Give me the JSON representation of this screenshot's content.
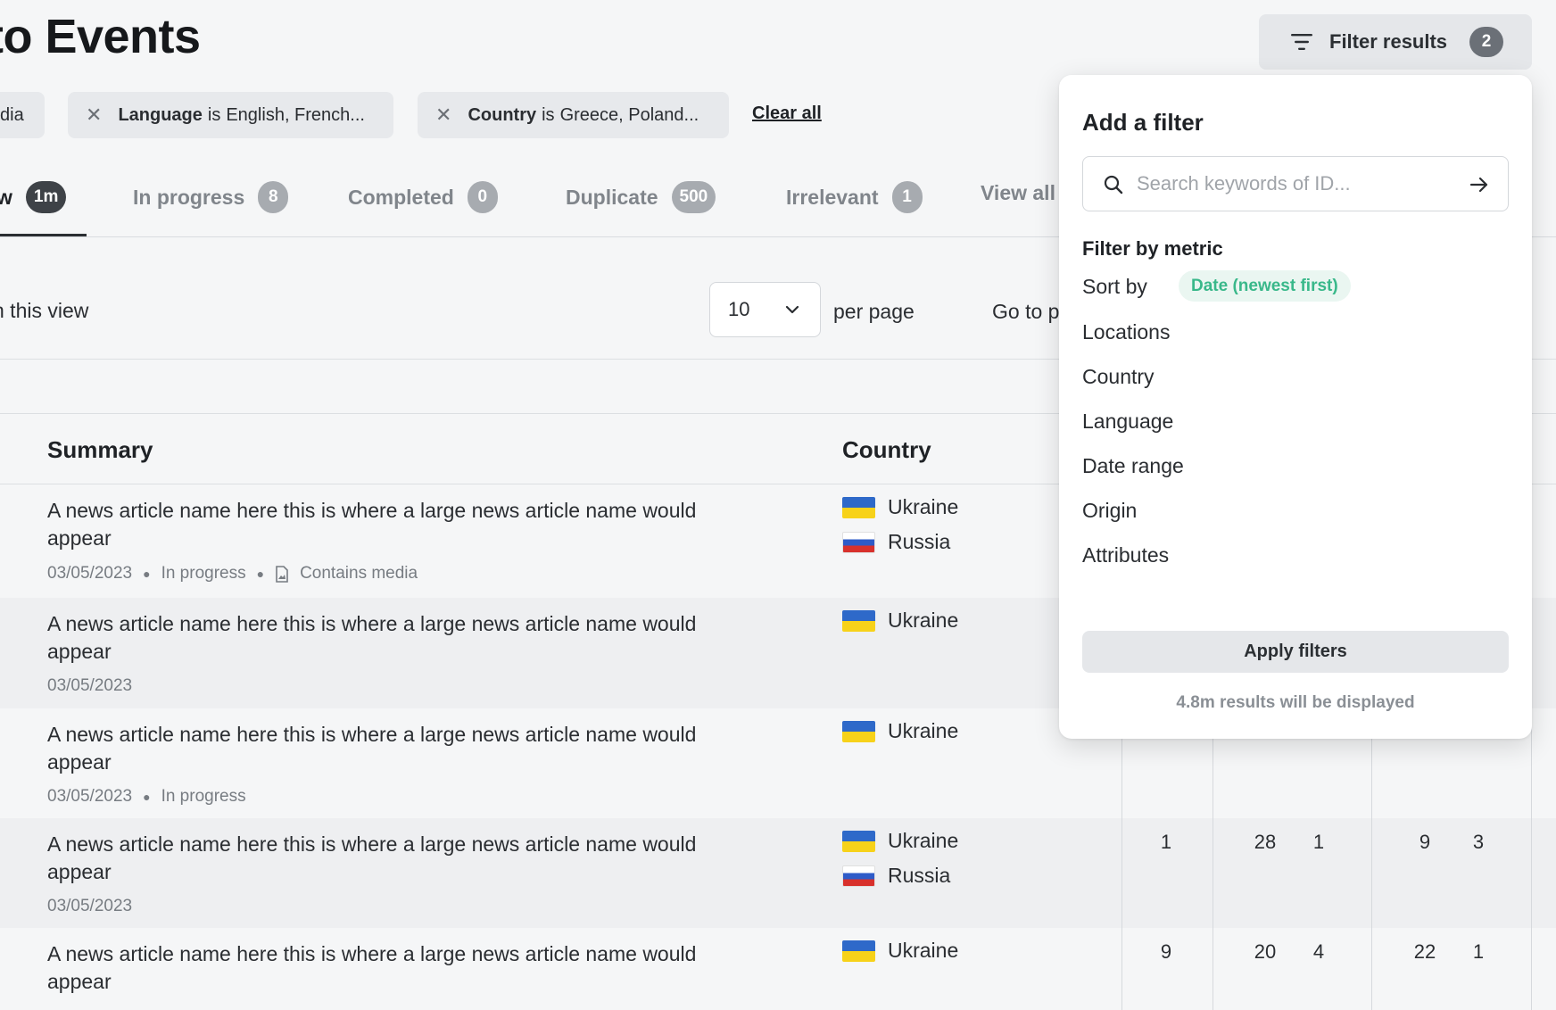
{
  "header": {
    "title": "to Events",
    "filter_button_label": "Filter results",
    "filter_count": "2"
  },
  "chips": [
    {
      "text": "dia"
    },
    {
      "key": "Language",
      "op": "is",
      "value": "English, French..."
    },
    {
      "key": "Country",
      "op": "is",
      "value": "Greece, Poland..."
    }
  ],
  "clear_all_label": "Clear all",
  "tabs": [
    {
      "label": "w",
      "count": "1m",
      "active": true
    },
    {
      "label": "In progress",
      "count": "8"
    },
    {
      "label": "Completed",
      "count": "0"
    },
    {
      "label": "Duplicate",
      "count": "500"
    },
    {
      "label": "Irrelevant",
      "count": "1"
    },
    {
      "label": "View all"
    }
  ],
  "pagination": {
    "view_text": "n this view",
    "per_page_value": "10",
    "per_page_label": "per page",
    "goto_label": "Go to p"
  },
  "table": {
    "headers": {
      "summary": "Summary",
      "country": "Country"
    },
    "rows": [
      {
        "title": "A news article name here this is where a large news article name would appear",
        "date": "03/05/2023",
        "status": "In progress",
        "media": "Contains media",
        "countries": [
          "Ukraine",
          "Russia"
        ],
        "values": []
      },
      {
        "title": "A news article name here this is where a large news article name would appear",
        "date": "03/05/2023",
        "countries": [
          "Ukraine"
        ],
        "values": []
      },
      {
        "title": "A news article name here this is where a large news article name would appear",
        "date": "03/05/2023",
        "status": "In progress",
        "countries": [
          "Ukraine"
        ],
        "values": []
      },
      {
        "title": "A news article name here this is where a large news article name would appear",
        "date": "03/05/2023",
        "countries": [
          "Ukraine",
          "Russia"
        ],
        "values": [
          "1",
          "28",
          "1",
          "9",
          "3"
        ]
      },
      {
        "title": "A news article name here this is where a large news article name would appear",
        "countries": [
          "Ukraine"
        ],
        "values": [
          "9",
          "20",
          "4",
          "22",
          "1"
        ]
      }
    ]
  },
  "popover": {
    "title": "Add a filter",
    "search_placeholder": "Search keywords of ID...",
    "section_label": "Filter by metric",
    "sort_by_label": "Sort by",
    "sort_by_value": "Date (newest first)",
    "metrics": [
      "Locations",
      "Country",
      "Language",
      "Date range",
      "Origin",
      "Attributes"
    ],
    "apply_label": "Apply filters",
    "results_note": "4.8m results will be displayed"
  },
  "colors": {
    "accent_green": "#39b88a",
    "badge_dark": "#3e4247",
    "badge_gray": "#a7abb0"
  }
}
